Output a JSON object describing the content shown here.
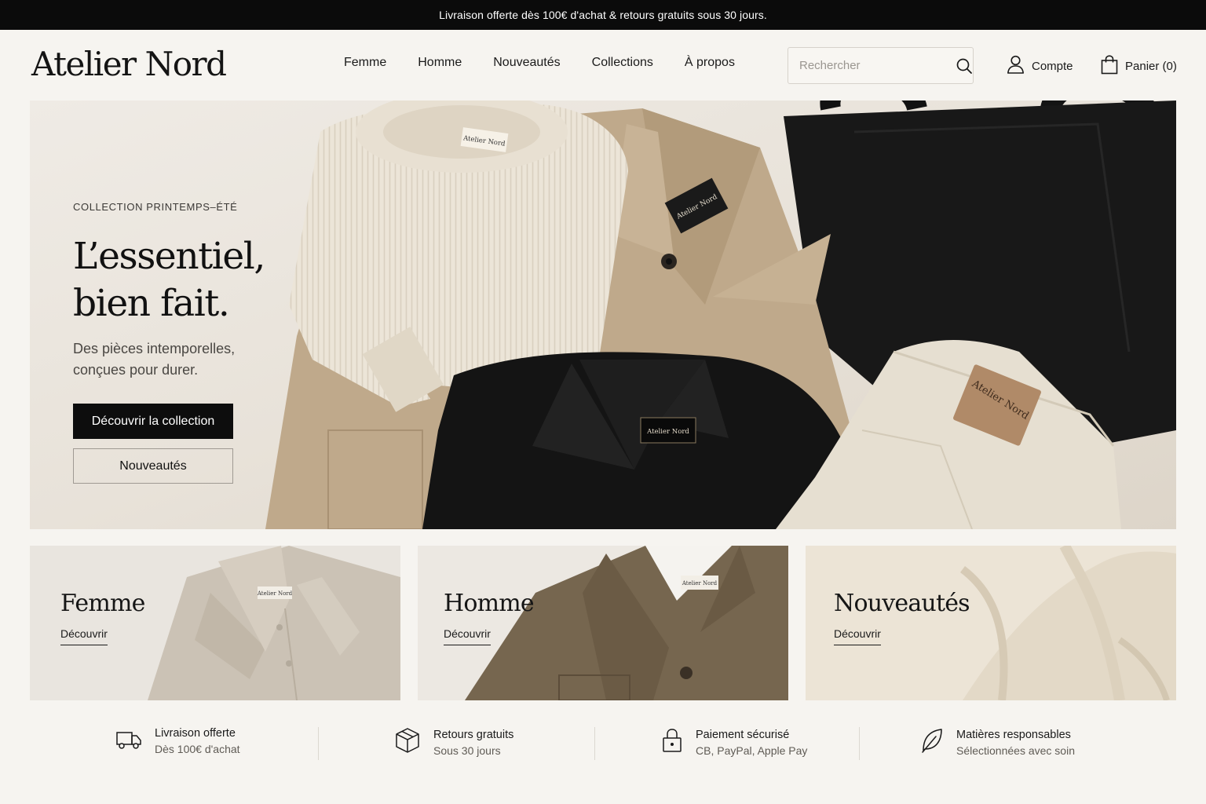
{
  "announcement": "Livraison offerte dès 100€ d'achat & retours gratuits sous 30 jours.",
  "header": {
    "logo": "Atelier Nord",
    "nav": [
      "Femme",
      "Homme",
      "Nouveautés",
      "Collections",
      "À propos"
    ],
    "search_placeholder": "Rechercher",
    "account_label": "Compte",
    "cart_label": "Panier (0)"
  },
  "hero": {
    "eyebrow": "COLLECTION PRINTEMPS–ÉTÉ",
    "title_line1": "L’essentiel,",
    "title_line2": "bien fait.",
    "subtitle": "Des pièces intemporelles, conçues pour durer.",
    "primary_cta": "Découvrir la collection",
    "secondary_cta": "Nouveautés",
    "labels": [
      "Atelier Nord",
      "Atelier Nord",
      "Atelier Nord",
      "Atelier Nord"
    ]
  },
  "categories": [
    {
      "title": "Femme",
      "link": "Découvrir",
      "label": "Atelier Nord"
    },
    {
      "title": "Homme",
      "link": "Découvrir",
      "label": "Atelier Nord"
    },
    {
      "title": "Nouveautés",
      "link": "Découvrir"
    }
  ],
  "trust": [
    {
      "title": "Livraison offerte",
      "subtitle": "Dès 100€ d'achat",
      "icon": "truck-icon"
    },
    {
      "title": "Retours gratuits",
      "subtitle": "Sous 30 jours",
      "icon": "box-icon"
    },
    {
      "title": "Paiement sécurisé",
      "subtitle": "CB, PayPal, Apple Pay",
      "icon": "lock-icon"
    },
    {
      "title": "Matières responsables",
      "subtitle": "Sélectionnées avec soin",
      "icon": "leaf-icon"
    }
  ],
  "colors": {
    "background": "#f6f4f0",
    "announcement_bg": "#0b0b0b",
    "primary_button": "#0d0d0d",
    "sweater": "#ece5d8",
    "jacket_khaki": "#bfa98b",
    "jacket_black": "#141414",
    "trousers_ecru": "#e6dfd1",
    "patch_leather": "#b08a68"
  }
}
